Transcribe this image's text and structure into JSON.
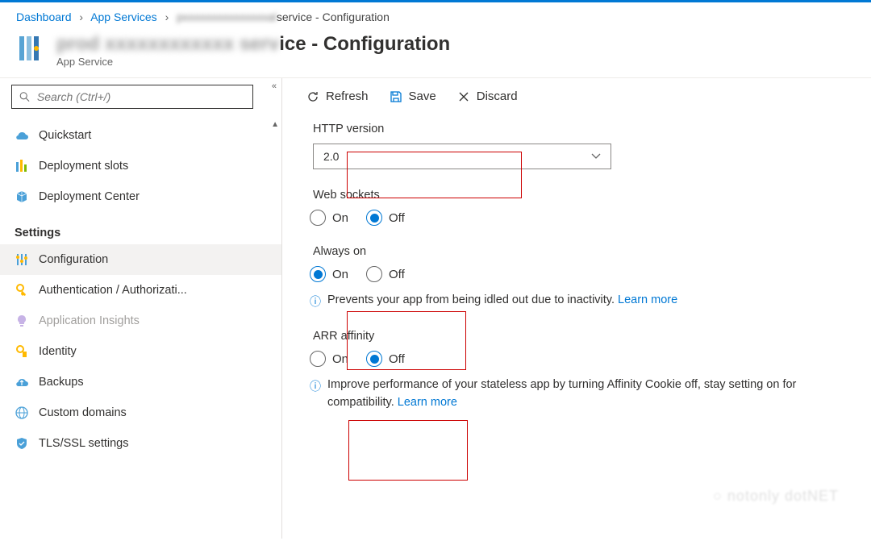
{
  "breadcrumb": {
    "items": [
      "Dashboard",
      "App Services"
    ],
    "current_suffix": "service - Configuration"
  },
  "header": {
    "title_suffix": "ice - Configuration",
    "subtitle": "App Service"
  },
  "sidebar": {
    "search_placeholder": "Search (Ctrl+/)",
    "section_label": "Settings",
    "items": [
      {
        "label": "Quickstart"
      },
      {
        "label": "Deployment slots"
      },
      {
        "label": "Deployment Center"
      },
      {
        "label": "Configuration"
      },
      {
        "label": "Authentication / Authorizati..."
      },
      {
        "label": "Application Insights"
      },
      {
        "label": "Identity"
      },
      {
        "label": "Backups"
      },
      {
        "label": "Custom domains"
      },
      {
        "label": "TLS/SSL settings"
      }
    ]
  },
  "toolbar": {
    "refresh": "Refresh",
    "save": "Save",
    "discard": "Discard"
  },
  "form": {
    "http_version": {
      "label": "HTTP version",
      "value": "2.0"
    },
    "web_sockets": {
      "label": "Web sockets",
      "on": "On",
      "off": "Off",
      "selected": "off"
    },
    "always_on": {
      "label": "Always on",
      "on": "On",
      "off": "Off",
      "selected": "on",
      "hint_prefix": "Prevents your app from being idled out due to inactivity. ",
      "learn_more": "Learn more"
    },
    "arr_affinity": {
      "label": "ARR affinity",
      "on": "On",
      "off": "Off",
      "selected": "off",
      "hint_prefix": "Improve performance of your stateless app by turning Affinity Cookie off, stay setting on for compatibility. ",
      "learn_more": "Learn more"
    }
  }
}
